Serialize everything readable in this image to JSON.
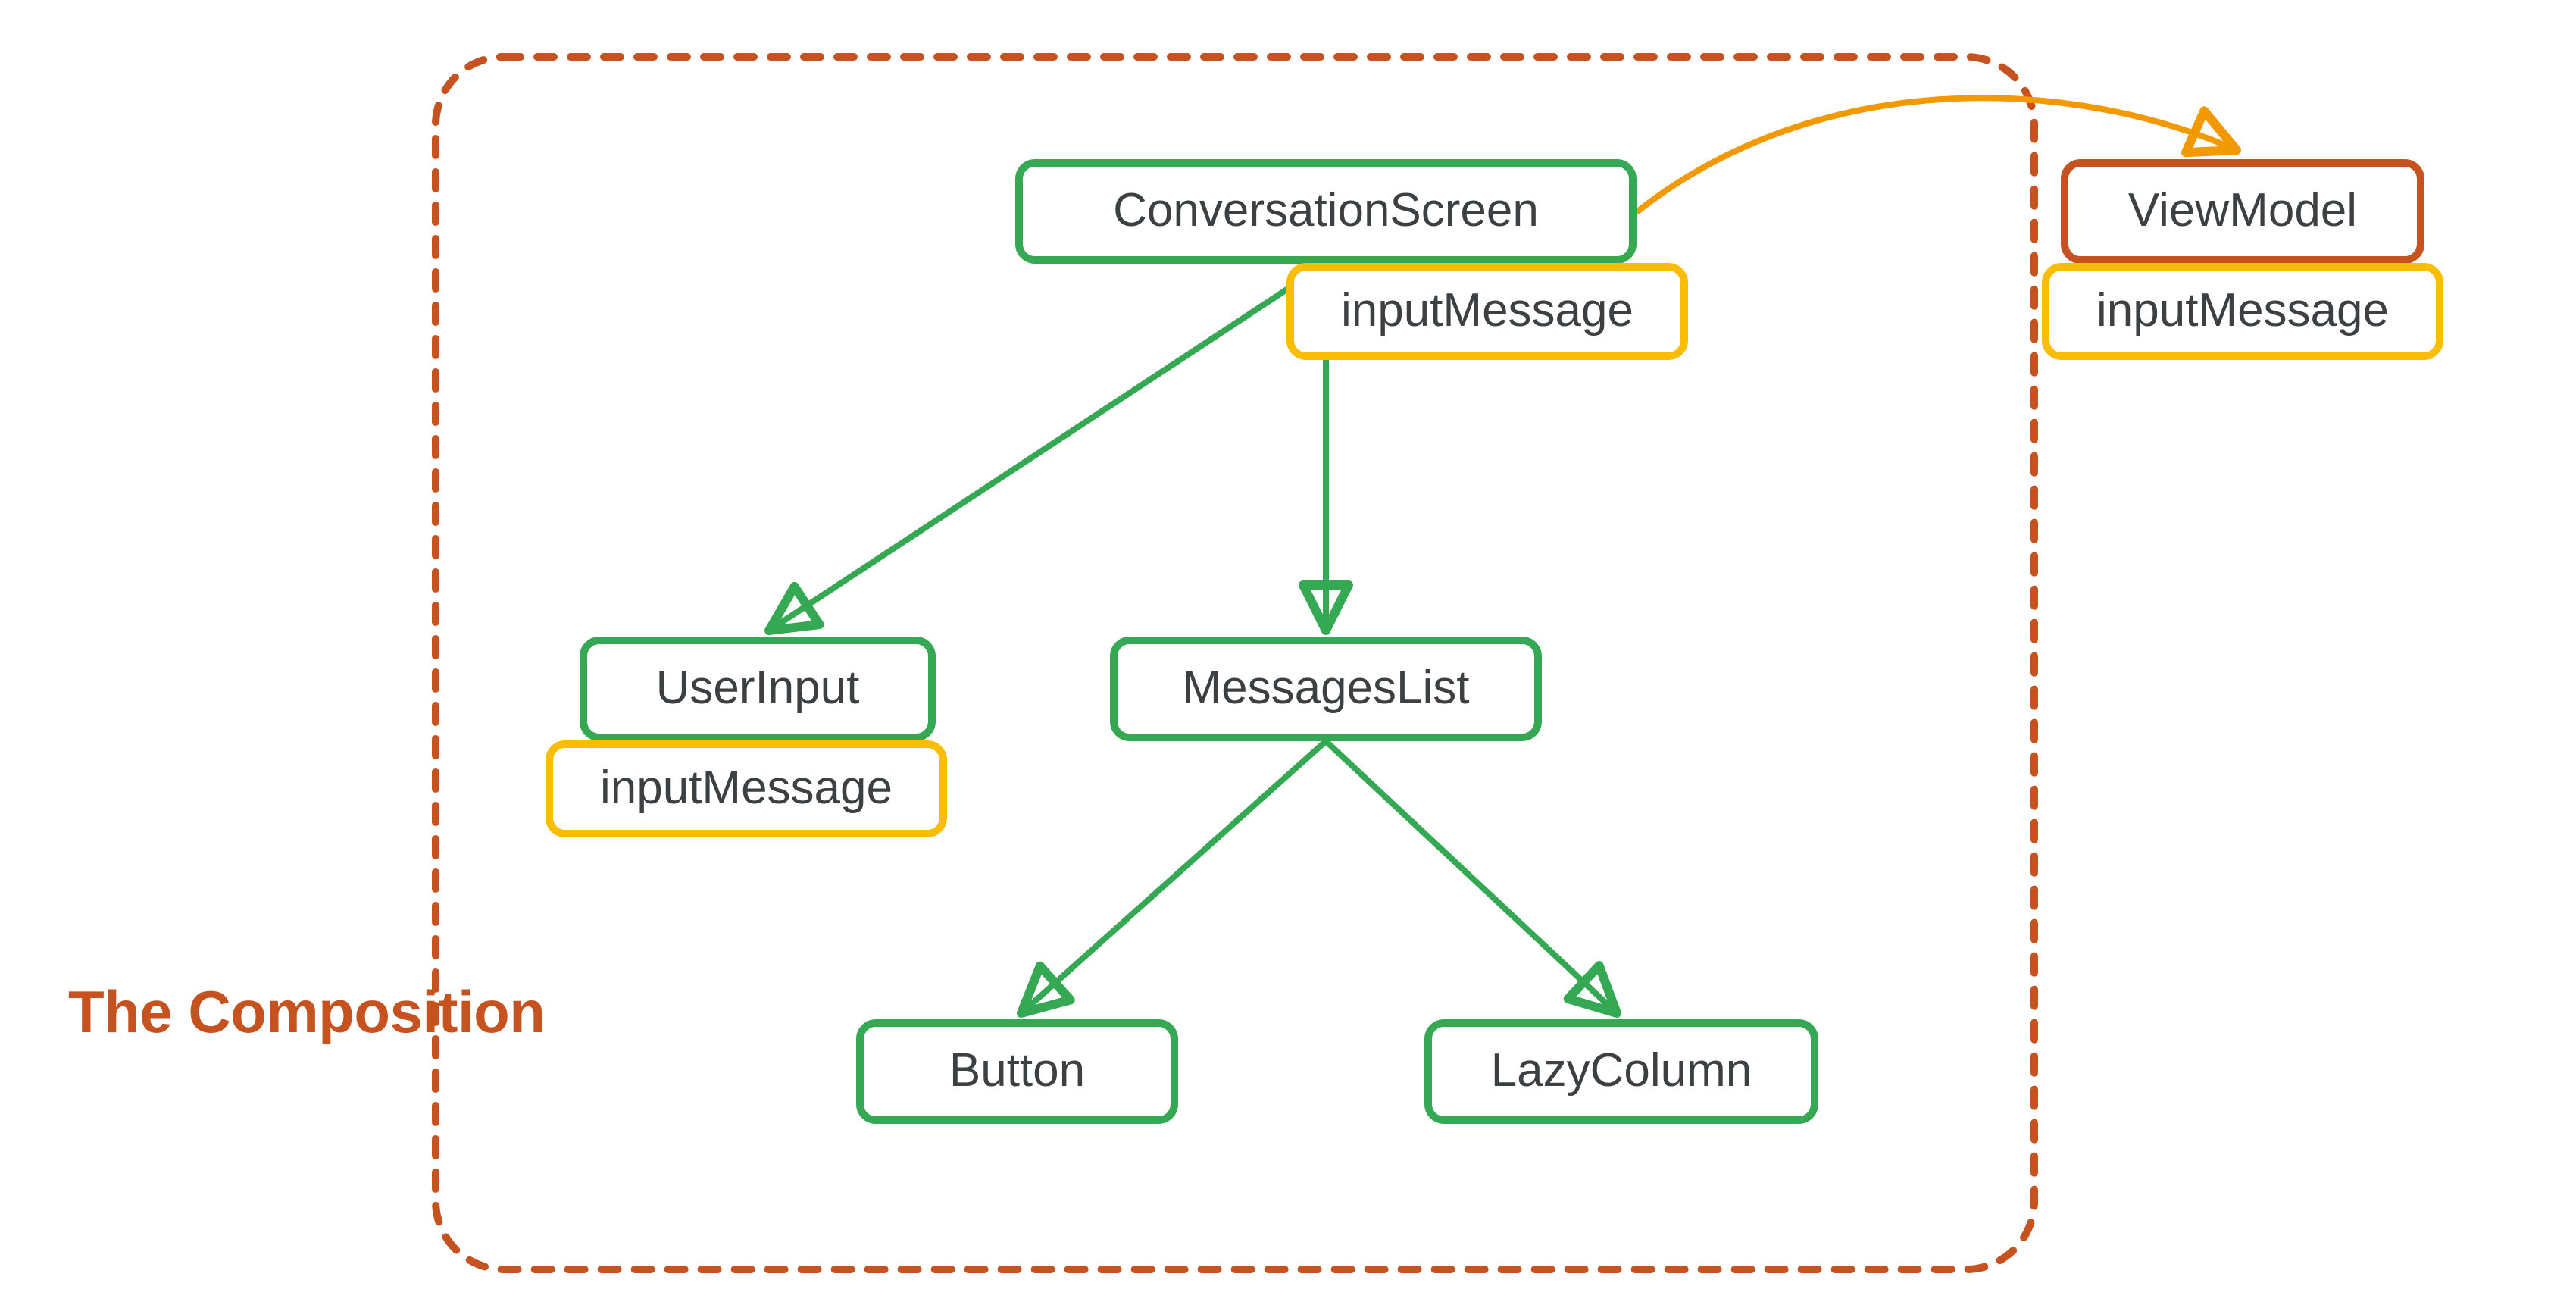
{
  "title": "The Composition",
  "colors": {
    "green": "#34a853",
    "yellow": "#fbbc04",
    "orange": "#c5521f",
    "text": "#3c4043"
  },
  "nodes": {
    "conversationScreen": {
      "label": "ConversationScreen",
      "kind": "composable"
    },
    "conversationScreen_state": {
      "label": "inputMessage",
      "kind": "state"
    },
    "userInput": {
      "label": "UserInput",
      "kind": "composable"
    },
    "userInput_state": {
      "label": "inputMessage",
      "kind": "state"
    },
    "messagesList": {
      "label": "MessagesList",
      "kind": "composable"
    },
    "button": {
      "label": "Button",
      "kind": "composable"
    },
    "lazyColumn": {
      "label": "LazyColumn",
      "kind": "composable"
    },
    "viewModel": {
      "label": "ViewModel",
      "kind": "viewmodel"
    },
    "viewModel_state": {
      "label": "inputMessage",
      "kind": "state"
    }
  },
  "edges": [
    {
      "from": "conversationScreen",
      "to": "userInput",
      "kind": "child"
    },
    {
      "from": "conversationScreen",
      "to": "messagesList",
      "kind": "child"
    },
    {
      "from": "messagesList",
      "to": "button",
      "kind": "child"
    },
    {
      "from": "messagesList",
      "to": "lazyColumn",
      "kind": "child"
    },
    {
      "from": "conversationScreen",
      "to": "viewModel",
      "kind": "reference"
    }
  ],
  "container": {
    "label": "The Composition",
    "contains": [
      "conversationScreen",
      "userInput",
      "messagesList",
      "button",
      "lazyColumn"
    ]
  }
}
